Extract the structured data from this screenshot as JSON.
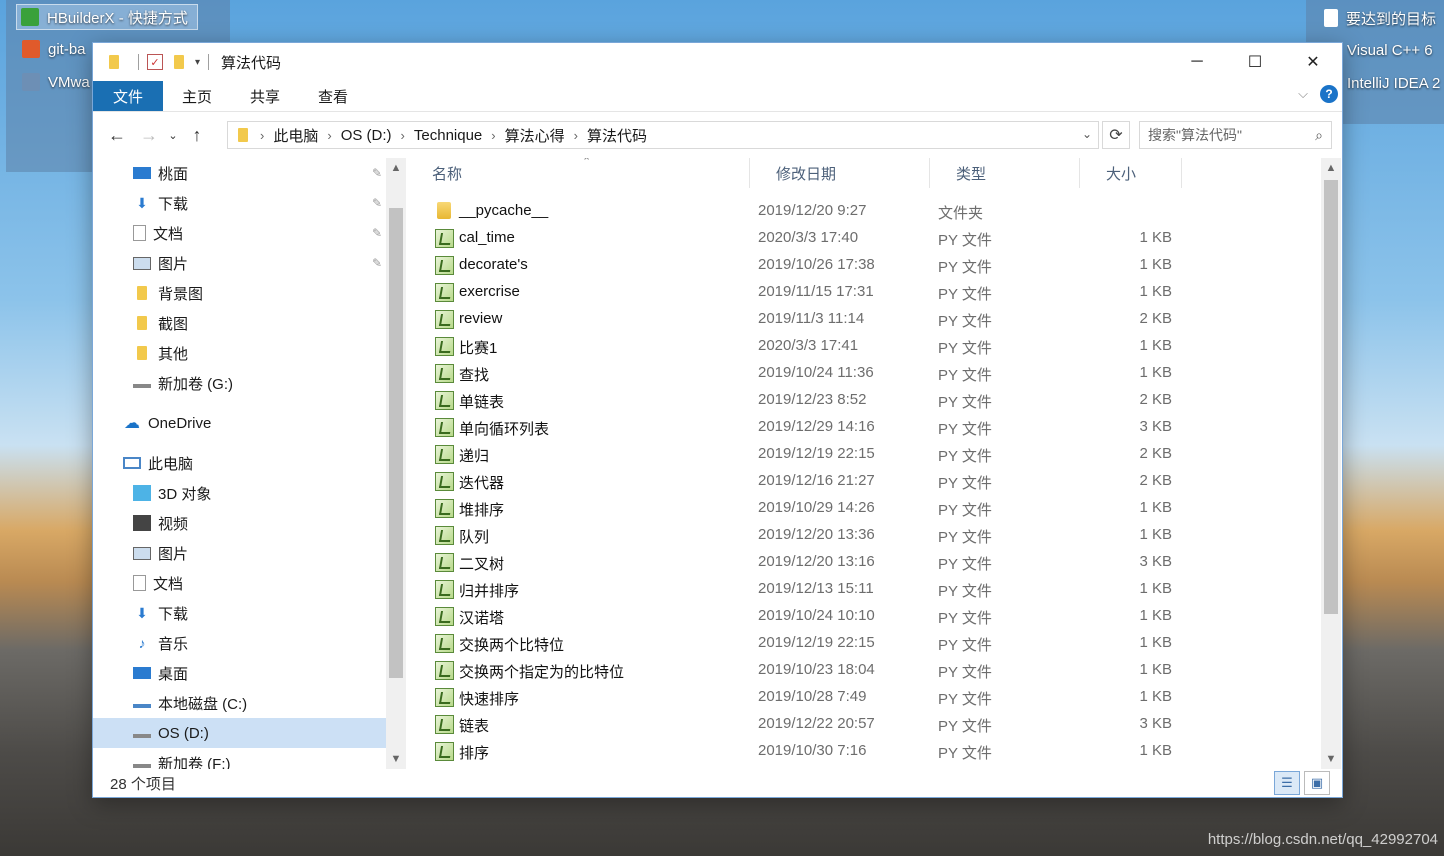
{
  "desktop": {
    "left_items": [
      "HBuilderX - 快捷方式",
      "git-ba",
      "VMwa"
    ],
    "right_items": [
      "要达到的目标",
      "Visual C++ 6",
      "IntelliJ IDEA 2"
    ],
    "watermark": "https://blog.csdn.net/qq_42992704"
  },
  "window": {
    "title": "算法代码",
    "controls": {
      "minimize": "─",
      "maximize": "☐",
      "close": "✕"
    }
  },
  "ribbon": {
    "tabs": [
      "文件",
      "主页",
      "共享",
      "查看"
    ],
    "help": "?"
  },
  "address": {
    "crumbs": [
      "此电脑",
      "OS (D:)",
      "Technique",
      "算法心得",
      "算法代码"
    ],
    "search_placeholder": "搜索\"算法代码\""
  },
  "nav": {
    "items": [
      {
        "label": "桃面",
        "icon": "desktop-icon",
        "pinned": true
      },
      {
        "label": "下载",
        "icon": "download-icon",
        "pinned": true
      },
      {
        "label": "文档",
        "icon": "document-icon",
        "pinned": true
      },
      {
        "label": "图片",
        "icon": "picture-icon",
        "pinned": true
      },
      {
        "label": "背景图",
        "icon": "folder-icon",
        "pinned": false
      },
      {
        "label": "截图",
        "icon": "folder-icon",
        "pinned": false
      },
      {
        "label": "其他",
        "icon": "folder-icon",
        "pinned": false
      },
      {
        "label": "新加卷 (G:)",
        "icon": "drive-icon",
        "pinned": false
      },
      {
        "label": "OneDrive",
        "icon": "onedrive-icon",
        "pinned": false
      },
      {
        "label": "此电脑",
        "icon": "computer-icon",
        "pinned": false
      },
      {
        "label": "3D 对象",
        "icon": "3d-objects-icon",
        "pinned": false
      },
      {
        "label": "视频",
        "icon": "video-icon",
        "pinned": false
      },
      {
        "label": "图片",
        "icon": "picture-icon",
        "pinned": false
      },
      {
        "label": "文档",
        "icon": "document-icon",
        "pinned": false
      },
      {
        "label": "下载",
        "icon": "download-icon",
        "pinned": false
      },
      {
        "label": "音乐",
        "icon": "music-icon",
        "pinned": false
      },
      {
        "label": "桌面",
        "icon": "desktop-icon",
        "pinned": false
      },
      {
        "label": "本地磁盘 (C:)",
        "icon": "drive-icon",
        "pinned": false
      },
      {
        "label": "OS (D:)",
        "icon": "drive-icon",
        "pinned": false,
        "selected": true
      },
      {
        "label": "新加卷 (F:)",
        "icon": "drive-icon",
        "pinned": false
      }
    ]
  },
  "columns": [
    "名称",
    "修改日期",
    "类型",
    "大小"
  ],
  "files": [
    {
      "name": "__pycache__",
      "date": "2019/12/20 9:27",
      "type": "文件夹",
      "size": "",
      "icon": "folder-icon"
    },
    {
      "name": "cal_time",
      "date": "2020/3/3 17:40",
      "type": "PY 文件",
      "size": "1 KB",
      "icon": "py-file-icon"
    },
    {
      "name": "decorate's",
      "date": "2019/10/26 17:38",
      "type": "PY 文件",
      "size": "1 KB",
      "icon": "py-file-icon"
    },
    {
      "name": "exercrise",
      "date": "2019/11/15 17:31",
      "type": "PY 文件",
      "size": "1 KB",
      "icon": "py-file-icon"
    },
    {
      "name": "review",
      "date": "2019/11/3 11:14",
      "type": "PY 文件",
      "size": "2 KB",
      "icon": "py-file-icon"
    },
    {
      "name": "比赛1",
      "date": "2020/3/3 17:41",
      "type": "PY 文件",
      "size": "1 KB",
      "icon": "py-file-icon"
    },
    {
      "name": "查找",
      "date": "2019/10/24 11:36",
      "type": "PY 文件",
      "size": "1 KB",
      "icon": "py-file-icon"
    },
    {
      "name": "单链表",
      "date": "2019/12/23 8:52",
      "type": "PY 文件",
      "size": "2 KB",
      "icon": "py-file-icon"
    },
    {
      "name": "单向循环列表",
      "date": "2019/12/29 14:16",
      "type": "PY 文件",
      "size": "3 KB",
      "icon": "py-file-icon"
    },
    {
      "name": "递归",
      "date": "2019/12/19 22:15",
      "type": "PY 文件",
      "size": "2 KB",
      "icon": "py-file-icon"
    },
    {
      "name": "迭代器",
      "date": "2019/12/16 21:27",
      "type": "PY 文件",
      "size": "2 KB",
      "icon": "py-file-icon"
    },
    {
      "name": "堆排序",
      "date": "2019/10/29 14:26",
      "type": "PY 文件",
      "size": "1 KB",
      "icon": "py-file-icon"
    },
    {
      "name": "队列",
      "date": "2019/12/20 13:36",
      "type": "PY 文件",
      "size": "1 KB",
      "icon": "py-file-icon"
    },
    {
      "name": "二叉树",
      "date": "2019/12/20 13:16",
      "type": "PY 文件",
      "size": "3 KB",
      "icon": "py-file-icon"
    },
    {
      "name": "归并排序",
      "date": "2019/12/13 15:11",
      "type": "PY 文件",
      "size": "1 KB",
      "icon": "py-file-icon"
    },
    {
      "name": "汉诺塔",
      "date": "2019/10/24 10:10",
      "type": "PY 文件",
      "size": "1 KB",
      "icon": "py-file-icon"
    },
    {
      "name": "交换两个比特位",
      "date": "2019/12/19 22:15",
      "type": "PY 文件",
      "size": "1 KB",
      "icon": "py-file-icon"
    },
    {
      "name": "交换两个指定为的比特位",
      "date": "2019/10/23 18:04",
      "type": "PY 文件",
      "size": "1 KB",
      "icon": "py-file-icon"
    },
    {
      "name": "快速排序",
      "date": "2019/10/28 7:49",
      "type": "PY 文件",
      "size": "1 KB",
      "icon": "py-file-icon"
    },
    {
      "name": "链表",
      "date": "2019/12/22 20:57",
      "type": "PY 文件",
      "size": "3 KB",
      "icon": "py-file-icon"
    },
    {
      "name": "排序",
      "date": "2019/10/30 7:16",
      "type": "PY 文件",
      "size": "1 KB",
      "icon": "py-file-icon"
    }
  ],
  "status": {
    "count": "28 个项目"
  },
  "colors": {
    "accent": "#1a6fb3",
    "selection": "#cce0f5",
    "folder": "#f2c94c",
    "header_text": "#4c607a"
  }
}
